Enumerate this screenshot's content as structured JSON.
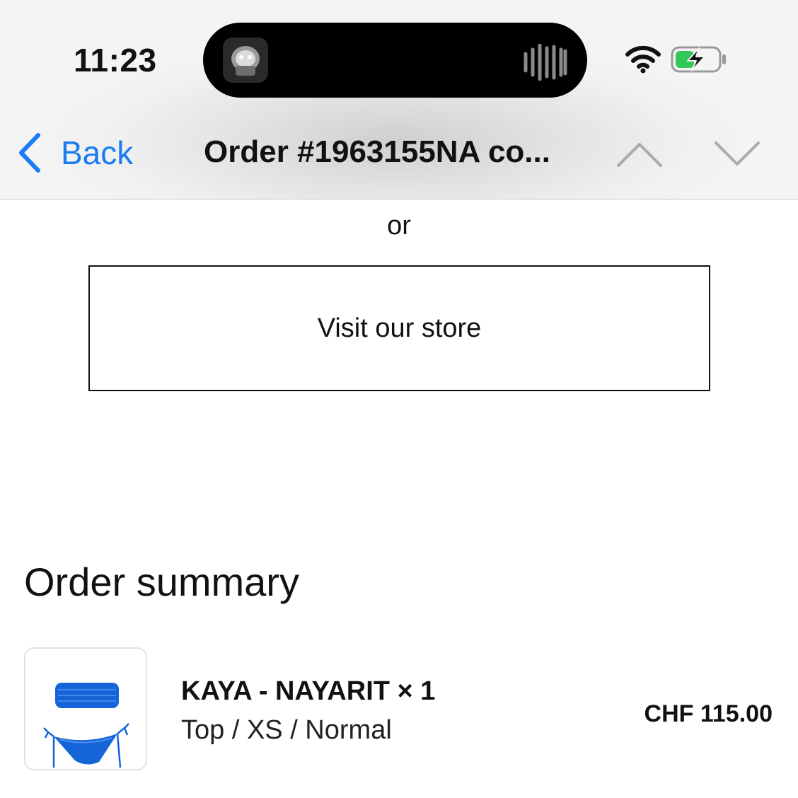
{
  "status_bar": {
    "time": "11:23"
  },
  "nav": {
    "back_label": "Back",
    "title": "Order #1963155NA co...",
    "accent_color": "#1a7cf5"
  },
  "content": {
    "or_text": "or",
    "store_button_label": "Visit our store",
    "summary_title": "Order summary"
  },
  "order_items": [
    {
      "name": "KAYA - NAYARIT × 1",
      "variant": "Top / XS / Normal",
      "price": "CHF 115.00",
      "thumbnail_icon": "blue-bikini-image"
    }
  ],
  "icons": [
    "back-chevron-icon",
    "chevron-up-icon",
    "chevron-down-icon",
    "wifi-icon",
    "battery-charging-icon",
    "audio-waveform-icon"
  ]
}
